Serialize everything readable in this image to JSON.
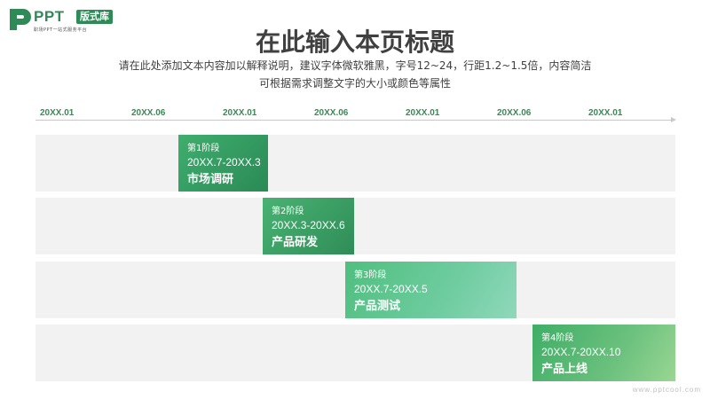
{
  "logo": {
    "ppt": "PPT",
    "badge": "版式库",
    "tagline": "职场PPT一站式服务平台"
  },
  "title": "在此输入本页标题",
  "subtitle_lines": [
    "请在此处添加文本内容加以解释说明，建议字体微软雅黑，字号12~24，行距1.2~1.5倍，内容简洁",
    "可根据需求调整文字的大小或颜色等属性"
  ],
  "axis_ticks": [
    "20XX.01",
    "20XX.06",
    "20XX.01",
    "20XX.06",
    "20XX.01",
    "20XX.06",
    "20XX.01"
  ],
  "stages": [
    {
      "num": "第1阶段",
      "range": "20XX.7-20XX.3",
      "name": "市场调研"
    },
    {
      "num": "第2阶段",
      "range": "20XX.3-20XX.6",
      "name": "产品研发"
    },
    {
      "num": "第3阶段",
      "range": "20XX.7-20XX.5",
      "name": "产品测试"
    },
    {
      "num": "第4阶段",
      "range": "20XX.7-20XX.10",
      "name": "产品上线"
    }
  ],
  "watermark": "www.pptcool.com",
  "colors": {
    "accent": "#2e8b57",
    "row_bg": "#f2f2f2",
    "title": "#404040"
  }
}
